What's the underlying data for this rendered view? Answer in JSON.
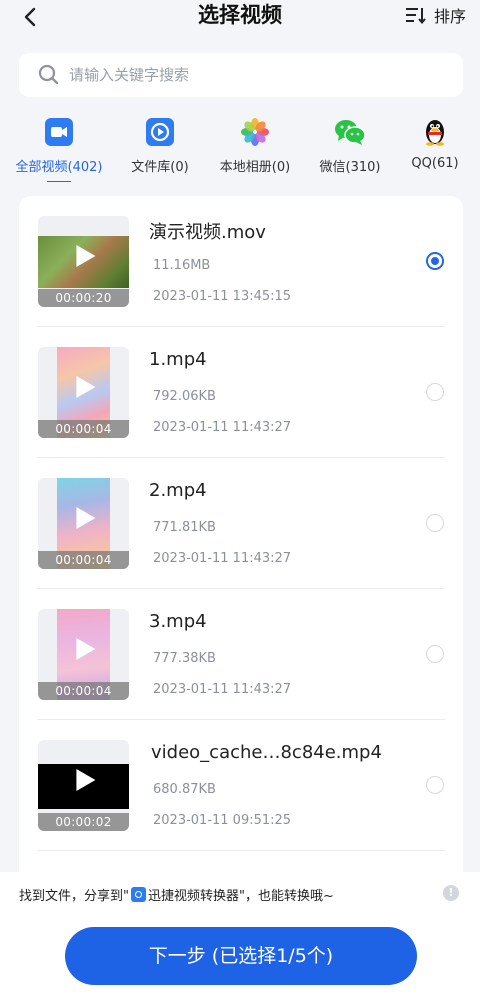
{
  "header": {
    "title": "选择视频",
    "sort_label": "排序"
  },
  "search": {
    "placeholder": "请输入关键字搜索",
    "value": ""
  },
  "tabs": [
    {
      "label": "全部视频(402)",
      "icon": "video-camera-icon",
      "active": true
    },
    {
      "label": "文件库(0)",
      "icon": "file-library-icon",
      "active": false
    },
    {
      "label": "本地相册(0)",
      "icon": "photos-icon",
      "active": false
    },
    {
      "label": "微信(310)",
      "icon": "wechat-icon",
      "active": false
    },
    {
      "label": "QQ(61)",
      "icon": "qq-penguin-icon",
      "active": false
    }
  ],
  "videos": [
    {
      "name": "演示视频.mov",
      "size": "11.16MB",
      "date": "2023-01-11 13:45:15",
      "duration": "00:00:20",
      "selected": true
    },
    {
      "name": "1.mp4",
      "size": "792.06KB",
      "date": "2023-01-11 11:43:27",
      "duration": "00:00:04",
      "selected": false
    },
    {
      "name": "2.mp4",
      "size": "771.81KB",
      "date": "2023-01-11 11:43:27",
      "duration": "00:00:04",
      "selected": false
    },
    {
      "name": "3.mp4",
      "size": "777.38KB",
      "date": "2023-01-11 11:43:27",
      "duration": "00:00:04",
      "selected": false
    },
    {
      "name": "video_cache…8c84e.mp4",
      "size": "680.87KB",
      "date": "2023-01-11 09:51:25",
      "duration": "00:00:02",
      "selected": false
    }
  ],
  "footer": {
    "tip_before": "找到文件，分享到\"",
    "tip_app": "迅捷视频转换器",
    "tip_after": "\"，也能转换哦~",
    "next_button": "下一步 (已选择1/5个)"
  },
  "colors": {
    "accent": "#1e62e6",
    "background": "#f3f5f9"
  }
}
